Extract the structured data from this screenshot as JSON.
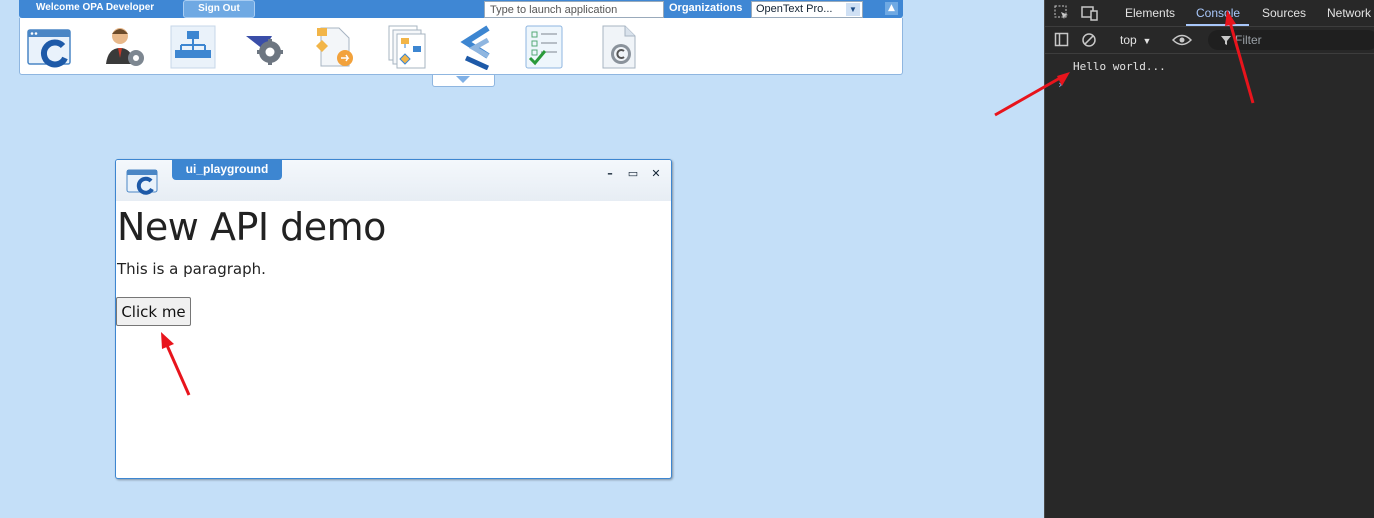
{
  "topbar": {
    "welcome": "Welcome OPA Developer",
    "signout_label": "Sign Out",
    "launch_placeholder": "Type to launch application",
    "org_label": "Organizations",
    "org_value": "OpenText Pro..."
  },
  "app_icons": [
    {
      "name": "app-window-icon"
    },
    {
      "name": "user-admin-icon"
    },
    {
      "name": "org-chart-icon"
    },
    {
      "name": "settings-gear-icon"
    },
    {
      "name": "process-flow-icon"
    },
    {
      "name": "workflow-pages-icon"
    },
    {
      "name": "chevron-stack-icon"
    },
    {
      "name": "task-checklist-icon"
    },
    {
      "name": "copyright-document-icon"
    }
  ],
  "window": {
    "tab_title": "ui_playground",
    "heading": "New API demo",
    "paragraph": "This is a paragraph.",
    "button_label": "Click me"
  },
  "devtools": {
    "tabs": [
      "Elements",
      "Console",
      "Sources",
      "Network"
    ],
    "active_tab": "Console",
    "context": "top",
    "filter_placeholder": "Filter",
    "console_output": "Hello world...",
    "accent_color": "#a8c7fa"
  },
  "annotation_color": "#e8141c"
}
